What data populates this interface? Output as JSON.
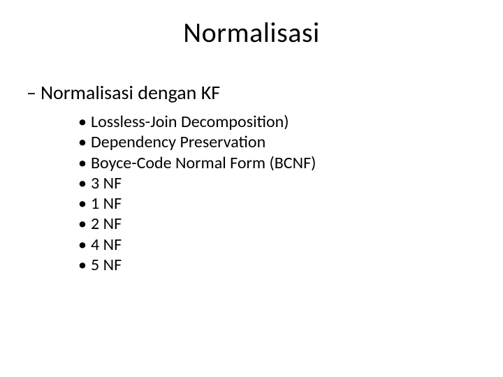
{
  "title": "Normalisasi",
  "subhead": {
    "dash": "–",
    "text": "Normalisasi dengan KF"
  },
  "items": [
    "Lossless-Join Decomposition)",
    "Dependency Preservation",
    "Boyce-Code Normal Form (BCNF)",
    "3 NF",
    "1 NF",
    "2 NF",
    "4 NF",
    "5 NF"
  ],
  "bullet_char": "•"
}
